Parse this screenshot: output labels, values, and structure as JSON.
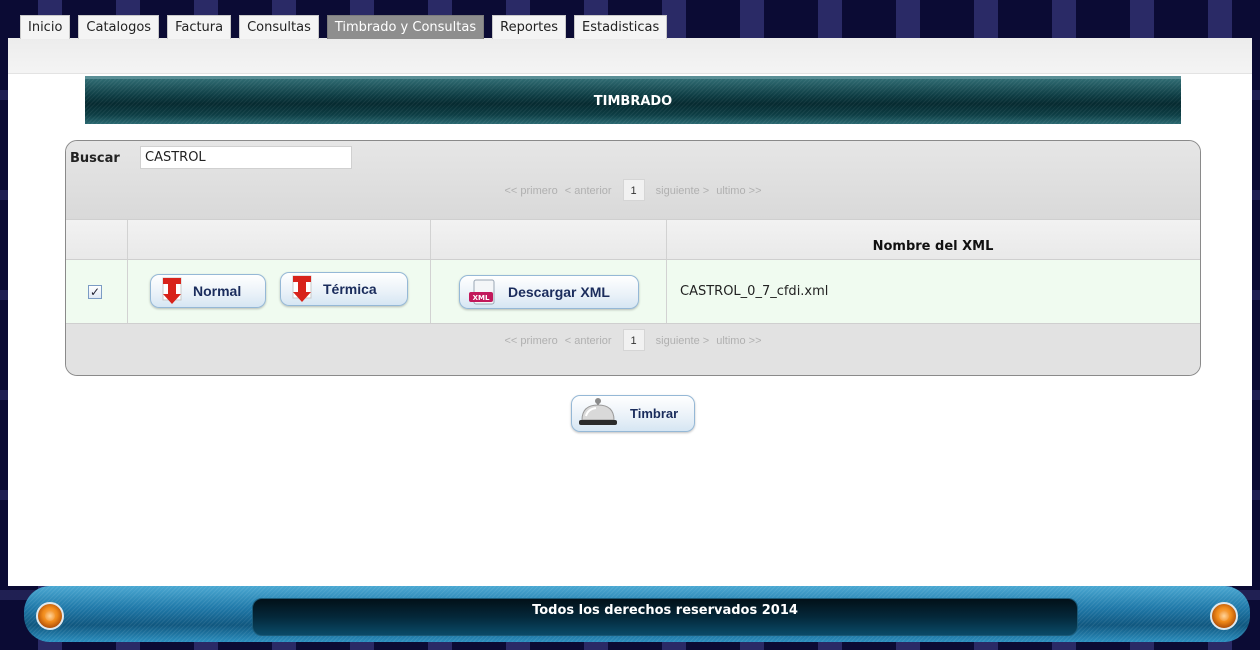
{
  "tabs": [
    {
      "label": "Inicio",
      "active": false
    },
    {
      "label": "Catalogos",
      "active": false
    },
    {
      "label": "Factura",
      "active": false
    },
    {
      "label": "Consultas",
      "active": false
    },
    {
      "label": "Timbrado y Consultas",
      "active": true
    },
    {
      "label": "Reportes",
      "active": false
    },
    {
      "label": "Estadisticas",
      "active": false
    }
  ],
  "section": {
    "title": "TIMBRADO"
  },
  "search": {
    "label": "Buscar",
    "value": "CASTROL"
  },
  "pager": {
    "first": "<< primero",
    "prev": "< anterior",
    "page": "1",
    "next": "siguiente >",
    "last": "ultimo >>"
  },
  "table": {
    "headers": [
      "",
      "",
      "",
      "Nombre del XML"
    ],
    "rows": [
      {
        "checked": true,
        "normal_label": "Normal",
        "termica_label": "Térmica",
        "download_label": "Descargar XML",
        "xml_icon_text": "XML",
        "xml_name": "CASTROL_0_7_cfdi.xml"
      }
    ]
  },
  "actions": {
    "timbrar_label": "Timbrar"
  },
  "footer": {
    "text": "Todos los derechos reservados 2014"
  },
  "colors": {
    "header_teal": "#0f3f46",
    "footer_blue": "#1f78a8",
    "row_highlight": "#f0fbf0",
    "active_tab": "#8e8e8e",
    "button_text": "#1a2c5c"
  }
}
